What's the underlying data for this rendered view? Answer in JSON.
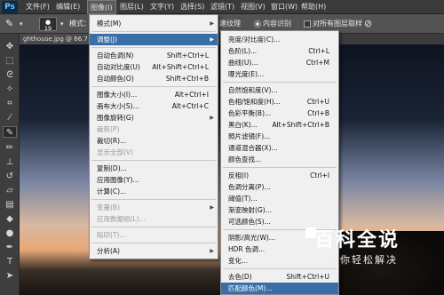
{
  "app": {
    "logo": "Ps"
  },
  "menubar": [
    {
      "label": "文件(F)",
      "active": false
    },
    {
      "label": "编辑(E)",
      "active": false
    },
    {
      "label": "图像(I)",
      "active": true
    },
    {
      "label": "图层(L)",
      "active": false
    },
    {
      "label": "文字(Y)",
      "active": false
    },
    {
      "label": "选择(S)",
      "active": false
    },
    {
      "label": "滤镜(T)",
      "active": false
    },
    {
      "label": "视图(V)",
      "active": false
    },
    {
      "label": "窗口(W)",
      "active": false
    },
    {
      "label": "帮助(H)",
      "active": false
    }
  ],
  "options": {
    "brush_size": "19",
    "mode_label": "模式：",
    "texture_label": "建纹理",
    "content_aware_label": "内容识别",
    "sample_all_label": "对所有图层取样"
  },
  "document": {
    "tab_label": "ghthouse.jpg @ 66.7"
  },
  "image_menu": [
    {
      "label": "模式(M)",
      "shortcut": "",
      "submenu": true,
      "disabled": false,
      "sep_before": false,
      "highlight": false
    },
    {
      "label": "调整(J)",
      "shortcut": "",
      "submenu": true,
      "disabled": false,
      "sep_before": true,
      "highlight": true
    },
    {
      "label": "自动色调(N)",
      "shortcut": "Shift+Ctrl+L",
      "submenu": false,
      "disabled": false,
      "sep_before": true,
      "highlight": false
    },
    {
      "label": "自动对比度(U)",
      "shortcut": "Alt+Shift+Ctrl+L",
      "submenu": false,
      "disabled": false,
      "sep_before": false,
      "highlight": false
    },
    {
      "label": "自动颜色(O)",
      "shortcut": "Shift+Ctrl+B",
      "submenu": false,
      "disabled": false,
      "sep_before": false,
      "highlight": false
    },
    {
      "label": "图像大小(I)...",
      "shortcut": "Alt+Ctrl+I",
      "submenu": false,
      "disabled": false,
      "sep_before": true,
      "highlight": false
    },
    {
      "label": "画布大小(S)...",
      "shortcut": "Alt+Ctrl+C",
      "submenu": false,
      "disabled": false,
      "sep_before": false,
      "highlight": false
    },
    {
      "label": "图像旋转(G)",
      "shortcut": "",
      "submenu": true,
      "disabled": false,
      "sep_before": false,
      "highlight": false
    },
    {
      "label": "裁剪(P)",
      "shortcut": "",
      "submenu": false,
      "disabled": true,
      "sep_before": false,
      "highlight": false
    },
    {
      "label": "裁切(R)...",
      "shortcut": "",
      "submenu": false,
      "disabled": false,
      "sep_before": false,
      "highlight": false
    },
    {
      "label": "显示全部(V)",
      "shortcut": "",
      "submenu": false,
      "disabled": true,
      "sep_before": false,
      "highlight": false
    },
    {
      "label": "复制(D)...",
      "shortcut": "",
      "submenu": false,
      "disabled": false,
      "sep_before": true,
      "highlight": false
    },
    {
      "label": "应用图像(Y)...",
      "shortcut": "",
      "submenu": false,
      "disabled": false,
      "sep_before": false,
      "highlight": false
    },
    {
      "label": "计算(C)...",
      "shortcut": "",
      "submenu": false,
      "disabled": false,
      "sep_before": false,
      "highlight": false
    },
    {
      "label": "变量(B)",
      "shortcut": "",
      "submenu": true,
      "disabled": true,
      "sep_before": true,
      "highlight": false
    },
    {
      "label": "应用数据组(L)...",
      "shortcut": "",
      "submenu": false,
      "disabled": true,
      "sep_before": false,
      "highlight": false
    },
    {
      "label": "陷印(T)...",
      "shortcut": "",
      "submenu": false,
      "disabled": true,
      "sep_before": true,
      "highlight": false
    },
    {
      "label": "分析(A)",
      "shortcut": "",
      "submenu": true,
      "disabled": false,
      "sep_before": true,
      "highlight": false
    }
  ],
  "adjust_menu": [
    {
      "label": "亮度/对比度(C)...",
      "shortcut": "",
      "sep_before": false,
      "highlight": false
    },
    {
      "label": "色阶(L)...",
      "shortcut": "Ctrl+L",
      "sep_before": false,
      "highlight": false
    },
    {
      "label": "曲线(U)...",
      "shortcut": "Ctrl+M",
      "sep_before": false,
      "highlight": false
    },
    {
      "label": "曝光度(E)...",
      "shortcut": "",
      "sep_before": false,
      "highlight": false
    },
    {
      "label": "自然饱和度(V)...",
      "shortcut": "",
      "sep_before": true,
      "highlight": false
    },
    {
      "label": "色相/饱和度(H)...",
      "shortcut": "Ctrl+U",
      "sep_before": false,
      "highlight": false
    },
    {
      "label": "色彩平衡(B)...",
      "shortcut": "Ctrl+B",
      "sep_before": false,
      "highlight": false
    },
    {
      "label": "黑白(K)...",
      "shortcut": "Alt+Shift+Ctrl+B",
      "sep_before": false,
      "highlight": false
    },
    {
      "label": "照片滤镜(F)...",
      "shortcut": "",
      "sep_before": false,
      "highlight": false
    },
    {
      "label": "通道混合器(X)...",
      "shortcut": "",
      "sep_before": false,
      "highlight": false
    },
    {
      "label": "颜色查找...",
      "shortcut": "",
      "sep_before": false,
      "highlight": false
    },
    {
      "label": "反相(I)",
      "shortcut": "Ctrl+I",
      "sep_before": true,
      "highlight": false
    },
    {
      "label": "色调分离(P)...",
      "shortcut": "",
      "sep_before": false,
      "highlight": false
    },
    {
      "label": "阈值(T)...",
      "shortcut": "",
      "sep_before": false,
      "highlight": false
    },
    {
      "label": "渐变映射(G)...",
      "shortcut": "",
      "sep_before": false,
      "highlight": false
    },
    {
      "label": "可选颜色(S)...",
      "shortcut": "",
      "sep_before": false,
      "highlight": false
    },
    {
      "label": "阴影/高光(W)...",
      "shortcut": "",
      "sep_before": true,
      "highlight": false
    },
    {
      "label": "HDR 色调...",
      "shortcut": "",
      "sep_before": false,
      "highlight": false
    },
    {
      "label": "变化...",
      "shortcut": "",
      "sep_before": false,
      "highlight": false
    },
    {
      "label": "去色(D)",
      "shortcut": "Shift+Ctrl+U",
      "sep_before": true,
      "highlight": false
    },
    {
      "label": "匹配颜色(M)...",
      "shortcut": "",
      "sep_before": false,
      "highlight": true
    }
  ],
  "watermark": {
    "title": "百科全说",
    "subtitle": "助你轻松解决"
  }
}
